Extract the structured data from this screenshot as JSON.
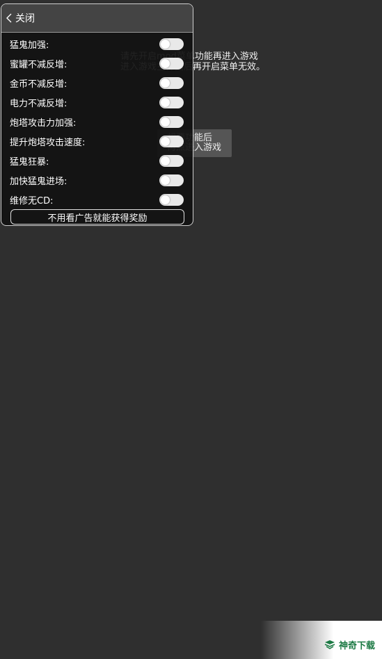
{
  "background_notice": {
    "line1": "请先开启mod菜单功能再进入游戏",
    "line2": "进入游戏主界面后再开启菜单无效。"
  },
  "hint": {
    "line1": "想要功能后",
    "line2": "再点进入游戏"
  },
  "panel": {
    "back_label": "关闭",
    "rows": [
      {
        "label": "猛鬼加强:",
        "enabled": false
      },
      {
        "label": "蜜罐不减反增:",
        "enabled": false
      },
      {
        "label": "金币不减反增:",
        "enabled": false
      },
      {
        "label": "电力不减反增:",
        "enabled": false
      },
      {
        "label": "炮塔攻击力加强:",
        "enabled": false
      },
      {
        "label": "提升炮塔攻击速度:",
        "enabled": false
      },
      {
        "label": "猛鬼狂暴:",
        "enabled": false
      },
      {
        "label": "加快猛鬼进场:",
        "enabled": false
      },
      {
        "label": "维修无CD:",
        "enabled": false
      }
    ],
    "reward_button": "不用看广告就能获得奖励"
  },
  "watermark": {
    "text": "神奇下载"
  },
  "colors": {
    "background": "#2f2f2f",
    "panel": "#121212",
    "switch_off": "#e9e9e9",
    "watermark_green": "#1c7a44"
  }
}
